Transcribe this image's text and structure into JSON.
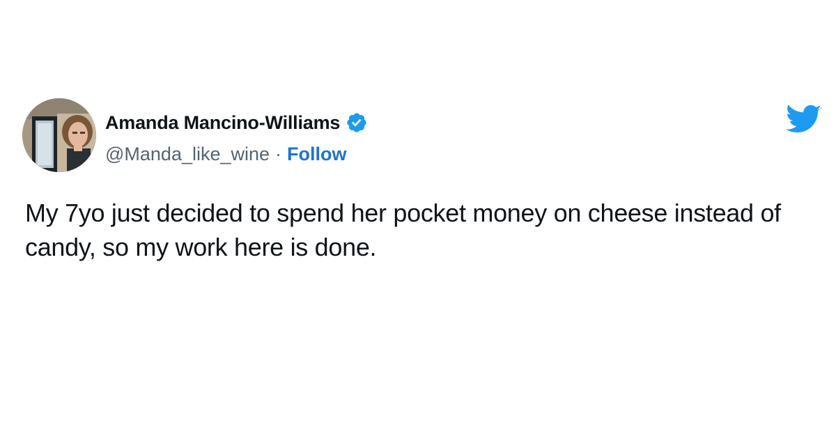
{
  "tweet": {
    "author": {
      "name": "Amanda Mancino-Williams",
      "handle": "@Manda_like_wine",
      "separator": "·",
      "follow_label": "Follow",
      "verified": true,
      "verified_icon": "verified-badge-icon",
      "avatar_icon": "avatar"
    },
    "text": "My 7yo just decided to spend her pocket money on cheese instead of candy, so my work here is done.",
    "brand_icon": "twitter-bird-icon"
  },
  "colors": {
    "text": "#0f1419",
    "secondary_text": "#536471",
    "link": "#1b74d1",
    "brand": "#1d9bf0",
    "background": "#ffffff"
  }
}
